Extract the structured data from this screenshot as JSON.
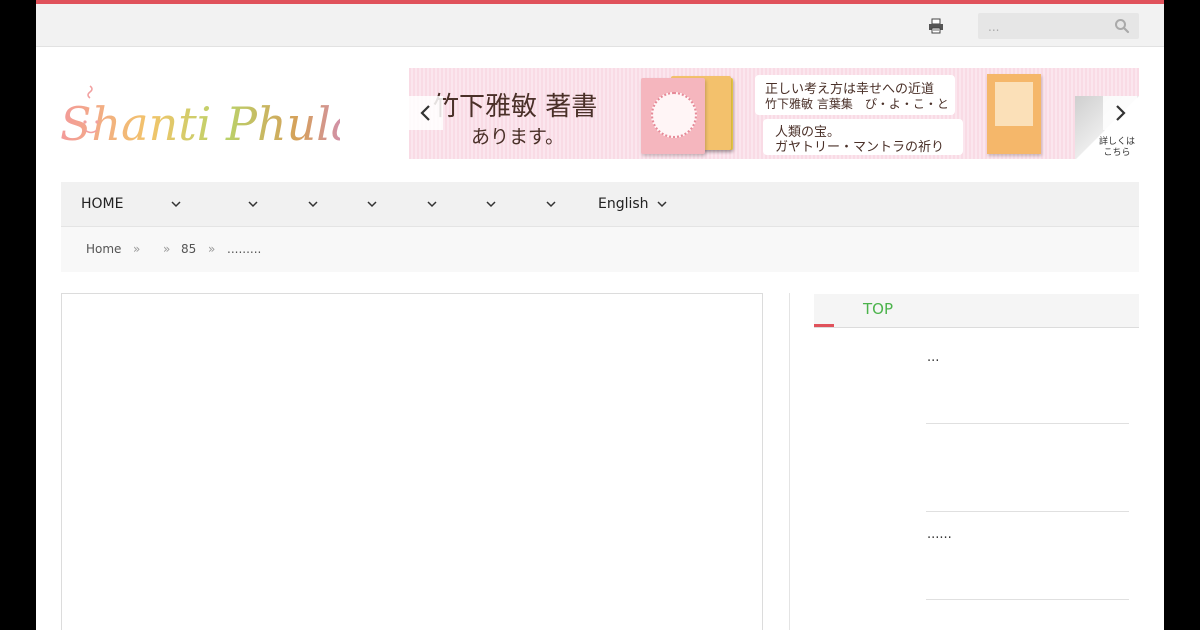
{
  "topbar": {
    "search_placeholder": "...",
    "print_icon": "printer-icon",
    "search_icon": "magnifier-icon"
  },
  "logo": {
    "text": "Shanti Phula"
  },
  "banner": {
    "title": "竹下雅敏 著書",
    "subtitle": "あります。",
    "bubble1_line1": "正しい考え方は幸せへの近道",
    "bubble1_line2": "竹下雅敏 言葉集　ぴ・よ・こ・と",
    "bubble2_line1": "人類の宝。",
    "bubble2_line2": "ガヤトリー・マントラの祈り",
    "detail_label": "詳しくは こちら"
  },
  "nav": {
    "items": [
      {
        "label": "HOME"
      },
      {
        "label": ""
      },
      {
        "label": ""
      },
      {
        "label": ""
      },
      {
        "label": ""
      },
      {
        "label": ""
      },
      {
        "label": ""
      },
      {
        "label": "English"
      }
    ]
  },
  "breadcrumb": {
    "home": "Home",
    "sep": "»",
    "item2": "85",
    "item3": "........."
  },
  "sidebar": {
    "title": "TOP",
    "text1": "...",
    "text2": "......"
  },
  "colors": {
    "accent": "#e0525b",
    "sidebar_title": "#4bb34b",
    "nav_bg": "#f1f1f1"
  }
}
